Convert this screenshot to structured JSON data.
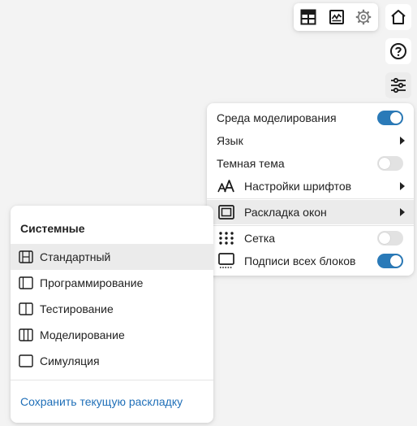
{
  "menu": {
    "items": [
      {
        "label": "Среда моделирования",
        "toggle": true
      },
      {
        "label": "Язык"
      },
      {
        "label": "Темная тема",
        "toggle": false
      },
      {
        "label": "Настройки шрифтов",
        "icon": "font-size-icon"
      },
      {
        "label": "Раскладка окон",
        "icon": "window-layout-icon"
      },
      {
        "label": "Сетка",
        "icon": "grid-dots-icon",
        "toggle": false
      },
      {
        "label": "Подписи всех блоков",
        "icon": "block-captions-icon",
        "toggle": true
      }
    ]
  },
  "layout_submenu": {
    "header": "Системные",
    "items": [
      {
        "label": "Стандартный",
        "icon": "layout-standard-icon"
      },
      {
        "label": "Программирование",
        "icon": "layout-programming-icon"
      },
      {
        "label": "Тестирование",
        "icon": "layout-testing-icon"
      },
      {
        "label": "Моделирование",
        "icon": "layout-modeling-icon"
      },
      {
        "label": "Симуляция",
        "icon": "layout-simulation-icon"
      }
    ],
    "save_link": "Сохранить текущую раскладку"
  },
  "colors": {
    "accent": "#2a7ab8",
    "link": "#1f6fb8",
    "toggle_off": "#e2e2e2",
    "hover_bg": "#ebebeb",
    "background": "#f3f3f3"
  }
}
